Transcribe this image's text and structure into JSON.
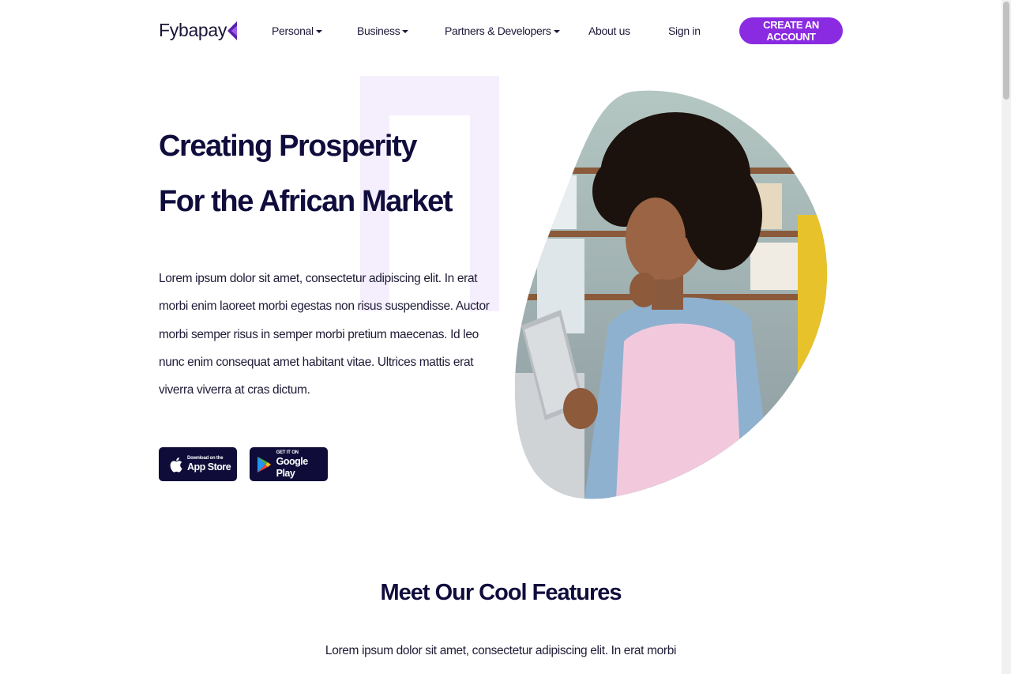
{
  "brand": {
    "name": "Fybapay",
    "accent": "#8a2be2",
    "dark": "#0f0c3a",
    "logo_icon": "chevron-left-logo-icon"
  },
  "nav": {
    "items": [
      {
        "label": "Personal",
        "dropdown": true
      },
      {
        "label": "Business",
        "dropdown": true
      },
      {
        "label": "Partners & Developers",
        "dropdown": true
      },
      {
        "label": "About us",
        "dropdown": false
      },
      {
        "label": "Sign in",
        "dropdown": false
      }
    ],
    "cta_label": "CREATE AN ACCOUNT"
  },
  "hero": {
    "title_line1": "Creating Prosperity",
    "title_line2": "For the African Market",
    "description": "Lorem ipsum dolor sit amet, consectetur adipiscing elit. In erat morbi enim laoreet morbi egestas non risus suspendisse. Auctor morbi semper risus in semper morbi pretium maecenas. Id leo nunc enim consequat amet habitant vitae. Ultrices mattis erat viverra viverra at cras dictum.",
    "app_store": {
      "small": "Download on the",
      "big": "App Store",
      "icon": "apple-icon"
    },
    "google_play": {
      "small": "GET IT ON",
      "big": "Google Play",
      "icon": "google-play-icon"
    }
  },
  "features": {
    "title": "Meet Our Cool Features",
    "description": "Lorem ipsum dolor sit amet, consectetur adipiscing elit. In erat morbi"
  }
}
